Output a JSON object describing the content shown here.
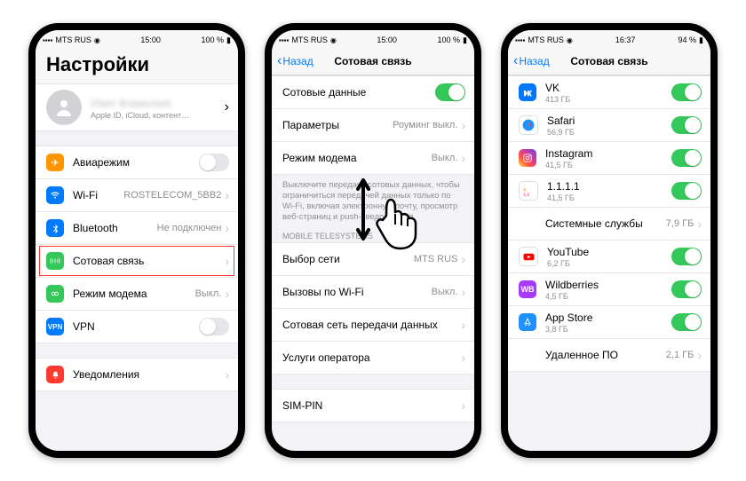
{
  "status": {
    "carrier": "MTS RUS",
    "time1": "15:00",
    "time2": "15:00",
    "time3": "16:37",
    "batt1": "100 %",
    "batt2": "100 %",
    "batt3": "94 %"
  },
  "p1": {
    "large_title": "Настройки",
    "profile": {
      "name": "Имя Фамилия",
      "sub": "Apple ID, iCloud, контент…"
    },
    "rows": {
      "airplane": "Авиарежим",
      "wifi": "Wi-Fi",
      "wifi_val": "ROSTELECOM_5BB2",
      "bt": "Bluetooth",
      "bt_val": "Не подключен",
      "cell": "Сотовая связь",
      "hotspot": "Режим модема",
      "hotspot_val": "Выкл.",
      "vpn": "VPN",
      "notif": "Уведомления"
    }
  },
  "p2": {
    "back": "Назад",
    "title": "Сотовая связь",
    "rows": {
      "data": "Сотовые данные",
      "params": "Параметры",
      "params_val": "Роуминг выкл.",
      "hotspot": "Режим модема",
      "hotspot_val": "Выкл.",
      "hint": "Выключите передачу сотовых данных, чтобы ограничиться передачей данных только по Wi-Fi, включая электронную почту, просмотр веб-страниц и push-уведомления.",
      "section": "MOBILE TELESYSTEMS",
      "netsel": "Выбор сети",
      "netsel_val": "MTS RUS",
      "wificall": "Вызовы по Wi-Fi",
      "wificall_val": "Выкл.",
      "cellnet": "Сотовая сеть передачи данных",
      "services": "Услуги оператора",
      "simpin": "SIM-PIN"
    }
  },
  "p3": {
    "back": "Назад",
    "title": "Сотовая связь",
    "apps": {
      "vk": {
        "name": "VK",
        "size": "413 ГБ"
      },
      "safari": {
        "name": "Safari",
        "size": "56,9 ГБ"
      },
      "ig": {
        "name": "Instagram",
        "size": "41,5 ГБ"
      },
      "one": {
        "name": "1.1.1.1",
        "size": "41,5 ГБ"
      },
      "sys": {
        "name": "Системные службы",
        "size": "7,9 ГБ"
      },
      "yt": {
        "name": "YouTube",
        "size": "6,2 ГБ"
      },
      "wb": {
        "name": "Wildberries",
        "size": "4,5 ГБ"
      },
      "as": {
        "name": "App Store",
        "size": "3,8 ГБ"
      },
      "del": {
        "name": "Удаленное ПО",
        "size": "2,1 ГБ"
      }
    }
  }
}
